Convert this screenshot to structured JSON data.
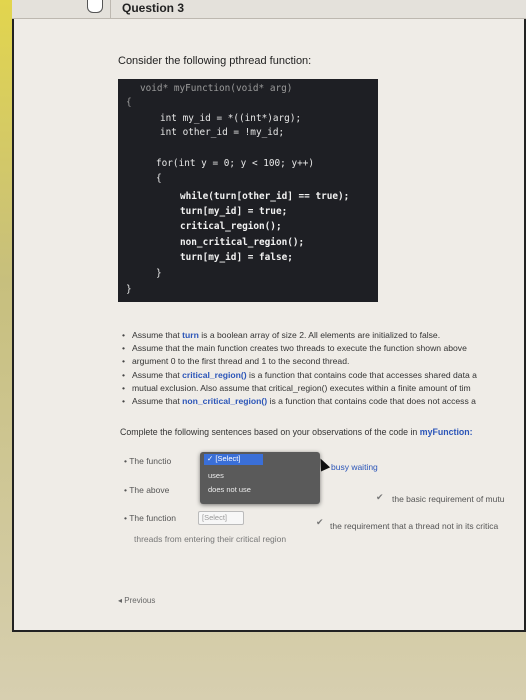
{
  "question": {
    "title": "Question 3",
    "prompt": "Consider the following pthread function:"
  },
  "code": {
    "lines": [
      {
        "text": "void* myFunction(void* arg)"
      },
      {
        "text": "{"
      },
      {
        "text": "int my_id = *((int*)arg);"
      },
      {
        "text": "int other_id = !my_id;"
      },
      {
        "text": "for(int y = 0; y < 100; y++)"
      },
      {
        "text": "{"
      },
      {
        "text": "while(turn[other_id] == true);"
      },
      {
        "text": "turn[my_id] = true;"
      },
      {
        "text": "critical_region();"
      },
      {
        "text": "non_critical_region();"
      },
      {
        "text": "turn[my_id] = false;"
      },
      {
        "text": "}"
      },
      {
        "text": "}"
      }
    ]
  },
  "bullets": [
    {
      "pre": "Assume that ",
      "hl": "turn",
      "post": " is a boolean array of size 2. All elements are initialized to false."
    },
    {
      "pre": "Assume that the main function creates two threads to execute the function shown above",
      "hl": "",
      "post": ""
    },
    {
      "pre": "argument 0 to the first thread and 1 to the second thread.",
      "hl": "",
      "post": ""
    },
    {
      "pre": "Assume that ",
      "hl": "critical_region()",
      "post": " is a function that contains code that accesses shared data a"
    },
    {
      "pre": "mutual exclusion. Also assume that critical_region() executes within a finite amount of tim",
      "hl": "",
      "post": ""
    },
    {
      "pre": "Assume that ",
      "hl": "non_critical_region()",
      "post": " is a function that contains code that does not access a"
    }
  ],
  "complete": {
    "pre": "Complete the following sentences based on your observations of the code in ",
    "fn": "myFunction:"
  },
  "sentences": {
    "s1_prefix": "The functio",
    "s1_suffix": "busy waiting",
    "s2_prefix": "The above",
    "s2_suffix": "the basic requirement of mutu",
    "s3_prefix": "The function",
    "s3_select": "[Select]",
    "s3_suffix": "the requirement that a thread not in its critica",
    "s3_line2": "threads from entering their critical region"
  },
  "popup": {
    "selected": "[Select]",
    "options": [
      "uses",
      "does not use"
    ]
  },
  "nav": {
    "previous": "Previous"
  }
}
